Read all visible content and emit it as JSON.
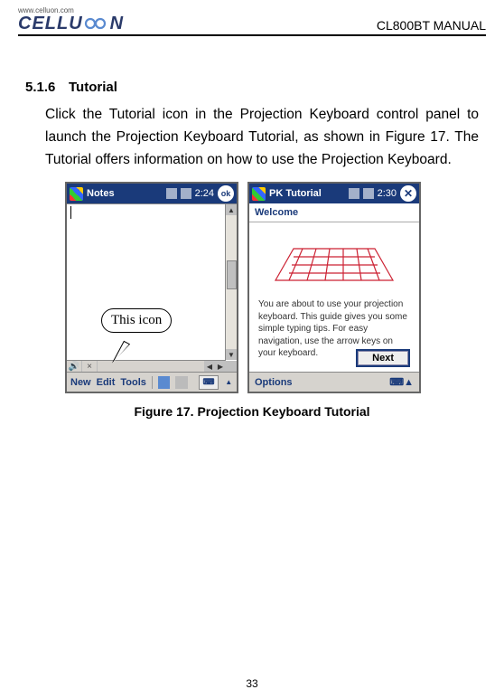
{
  "header": {
    "logo_url": "www.celluon.com",
    "logo_text_pre": "CELLU",
    "logo_text_post": "N",
    "manual_title": "CL800BT MANUAL"
  },
  "section": {
    "number": "5.1.6",
    "title": "Tutorial",
    "paragraph": "Click the Tutorial icon in the Projection Keyboard control panel to launch the Projection Keyboard Tutorial, as shown in Figure 17. The Tutorial offers information on how to use the Projection Keyboard."
  },
  "callout": {
    "label": "This icon"
  },
  "left_pda": {
    "app_title": "Notes",
    "time": "2:24",
    "ok_label": "ok",
    "menu": {
      "new": "New",
      "edit": "Edit",
      "tools": "Tools"
    }
  },
  "right_pda": {
    "app_title": "PK Tutorial",
    "time": "2:30",
    "welcome": "Welcome",
    "body_text": "You are about to use your projection keyboard. This guide gives you some simple typing tips. For easy navigation, use the arrow keys on your keyboard.",
    "next_label": "Next",
    "options_label": "Options"
  },
  "figure_caption": "Figure 17. Projection Keyboard Tutorial",
  "page_number": "33"
}
